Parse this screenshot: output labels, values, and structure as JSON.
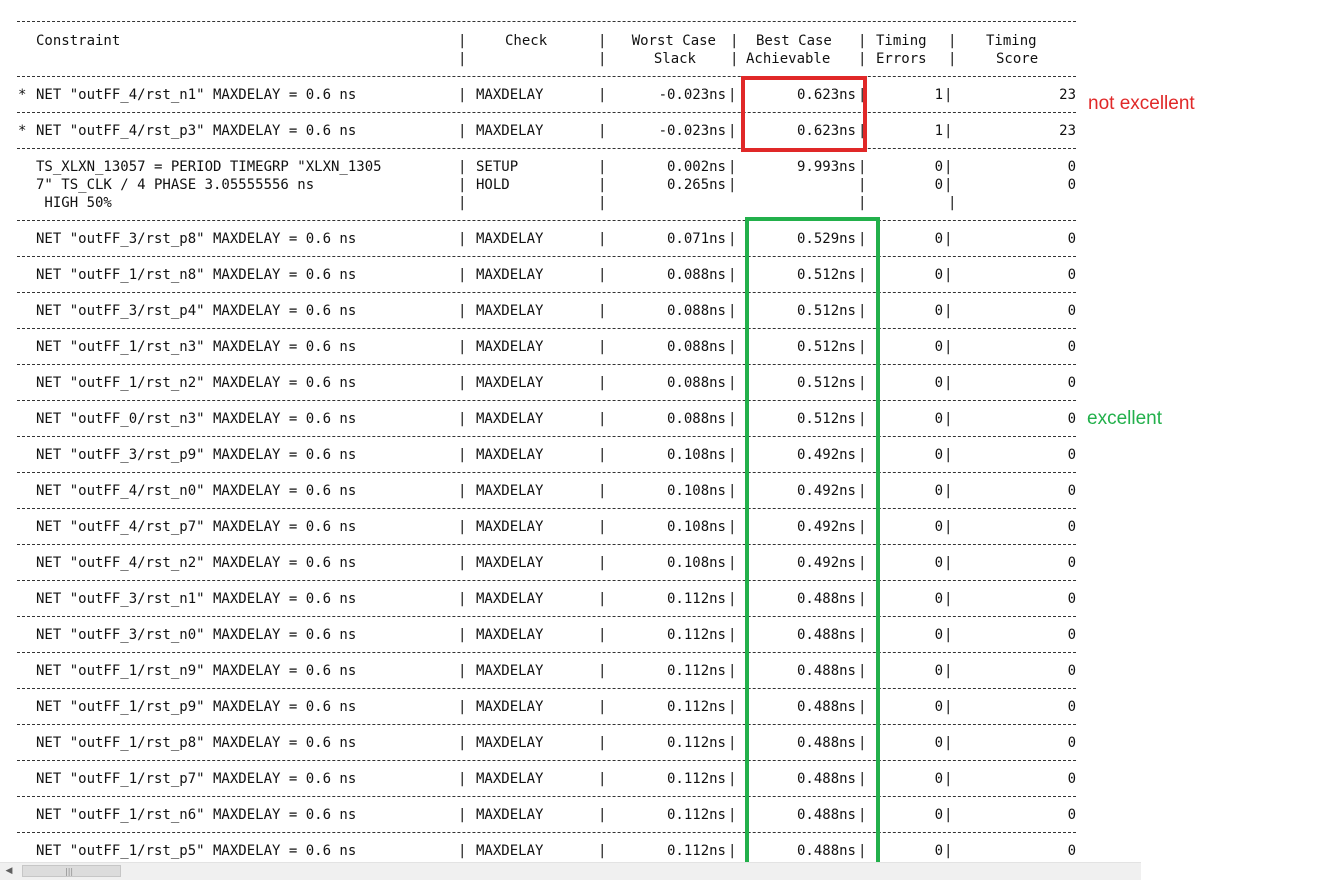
{
  "headers": {
    "constraint": "Constraint",
    "check": "Check",
    "worst_1": "Worst Case",
    "worst_2": "Slack",
    "best_1": "Best Case",
    "best_2": "Achievable",
    "errors_1": "Timing",
    "errors_2": "Errors",
    "score_1": "Timing",
    "score_2": "Score"
  },
  "rows": [
    {
      "star": "*",
      "constraint": "NET \"outFF_4/rst_n1\" MAXDELAY = 0.6 ns",
      "check": "MAXDELAY",
      "worst": "-0.023ns",
      "best": "0.623ns",
      "errors": "1",
      "score": "23"
    },
    {
      "star": "*",
      "constraint": "NET \"outFF_4/rst_p3\" MAXDELAY = 0.6 ns",
      "check": "MAXDELAY",
      "worst": "-0.023ns",
      "best": "0.623ns",
      "errors": "1",
      "score": "23"
    }
  ],
  "period_row": {
    "line1": "TS_XLXN_13057 = PERIOD TIMEGRP \"XLXN_1305",
    "line2": "7\" TS_CLK / 4 PHASE 3.05555556 ns",
    "line3": " HIGH 50%",
    "check1": "SETUP",
    "check2": "HOLD",
    "worst1": "0.002ns",
    "worst2": "0.265ns",
    "best1": "9.993ns",
    "errors1": "0",
    "errors2": "0",
    "score1": "0",
    "score2": "0"
  },
  "rows_b": [
    {
      "constraint": "NET \"outFF_3/rst_p8\" MAXDELAY = 0.6 ns",
      "check": "MAXDELAY",
      "worst": "0.071ns",
      "best": "0.529ns",
      "errors": "0",
      "score": "0"
    },
    {
      "constraint": "NET \"outFF_1/rst_n8\" MAXDELAY = 0.6 ns",
      "check": "MAXDELAY",
      "worst": "0.088ns",
      "best": "0.512ns",
      "errors": "0",
      "score": "0"
    },
    {
      "constraint": "NET \"outFF_3/rst_p4\" MAXDELAY = 0.6 ns",
      "check": "MAXDELAY",
      "worst": "0.088ns",
      "best": "0.512ns",
      "errors": "0",
      "score": "0"
    },
    {
      "constraint": "NET \"outFF_1/rst_n3\" MAXDELAY = 0.6 ns",
      "check": "MAXDELAY",
      "worst": "0.088ns",
      "best": "0.512ns",
      "errors": "0",
      "score": "0"
    },
    {
      "constraint": "NET \"outFF_1/rst_n2\" MAXDELAY = 0.6 ns",
      "check": "MAXDELAY",
      "worst": "0.088ns",
      "best": "0.512ns",
      "errors": "0",
      "score": "0"
    },
    {
      "constraint": "NET \"outFF_0/rst_n3\" MAXDELAY = 0.6 ns",
      "check": "MAXDELAY",
      "worst": "0.088ns",
      "best": "0.512ns",
      "errors": "0",
      "score": "0"
    },
    {
      "constraint": "NET \"outFF_3/rst_p9\" MAXDELAY = 0.6 ns",
      "check": "MAXDELAY",
      "worst": "0.108ns",
      "best": "0.492ns",
      "errors": "0",
      "score": "0"
    },
    {
      "constraint": "NET \"outFF_4/rst_n0\" MAXDELAY = 0.6 ns",
      "check": "MAXDELAY",
      "worst": "0.108ns",
      "best": "0.492ns",
      "errors": "0",
      "score": "0"
    },
    {
      "constraint": "NET \"outFF_4/rst_p7\" MAXDELAY = 0.6 ns",
      "check": "MAXDELAY",
      "worst": "0.108ns",
      "best": "0.492ns",
      "errors": "0",
      "score": "0"
    },
    {
      "constraint": "NET \"outFF_4/rst_n2\" MAXDELAY = 0.6 ns",
      "check": "MAXDELAY",
      "worst": "0.108ns",
      "best": "0.492ns",
      "errors": "0",
      "score": "0"
    },
    {
      "constraint": "NET \"outFF_3/rst_n1\" MAXDELAY = 0.6 ns",
      "check": "MAXDELAY",
      "worst": "0.112ns",
      "best": "0.488ns",
      "errors": "0",
      "score": "0"
    },
    {
      "constraint": "NET \"outFF_3/rst_n0\" MAXDELAY = 0.6 ns",
      "check": "MAXDELAY",
      "worst": "0.112ns",
      "best": "0.488ns",
      "errors": "0",
      "score": "0"
    },
    {
      "constraint": "NET \"outFF_1/rst_n9\" MAXDELAY = 0.6 ns",
      "check": "MAXDELAY",
      "worst": "0.112ns",
      "best": "0.488ns",
      "errors": "0",
      "score": "0"
    },
    {
      "constraint": "NET \"outFF_1/rst_p9\" MAXDELAY = 0.6 ns",
      "check": "MAXDELAY",
      "worst": "0.112ns",
      "best": "0.488ns",
      "errors": "0",
      "score": "0"
    },
    {
      "constraint": "NET \"outFF_1/rst_p8\" MAXDELAY = 0.6 ns",
      "check": "MAXDELAY",
      "worst": "0.112ns",
      "best": "0.488ns",
      "errors": "0",
      "score": "0"
    },
    {
      "constraint": "NET \"outFF_1/rst_p7\" MAXDELAY = 0.6 ns",
      "check": "MAXDELAY",
      "worst": "0.112ns",
      "best": "0.488ns",
      "errors": "0",
      "score": "0"
    },
    {
      "constraint": "NET \"outFF_1/rst_n6\" MAXDELAY = 0.6 ns",
      "check": "MAXDELAY",
      "worst": "0.112ns",
      "best": "0.488ns",
      "errors": "0",
      "score": "0"
    },
    {
      "constraint": "NET \"outFF_1/rst_p5\" MAXDELAY = 0.6 ns",
      "check": "MAXDELAY",
      "worst": "0.112ns",
      "best": "0.488ns",
      "errors": "0",
      "score": "0"
    }
  ],
  "annotations": {
    "not_excellent": "not excellent",
    "excellent": "excellent",
    "red_color": "#e02828",
    "green_color": "#22b04b"
  },
  "scrollbar": {
    "left_arrow": "◀",
    "thumb_grip": "|||"
  }
}
